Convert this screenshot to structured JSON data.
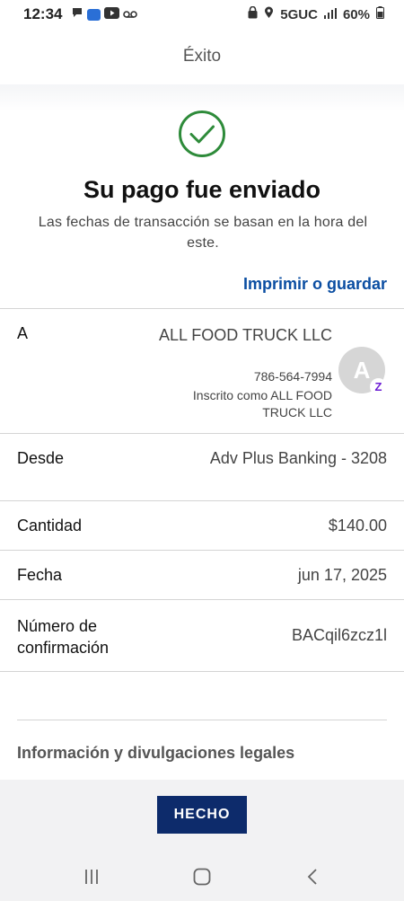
{
  "status_bar": {
    "time": "12:34",
    "network": "5GUC",
    "battery": "60%"
  },
  "header": {
    "title": "Éxito"
  },
  "confirmation": {
    "title": "Su pago fue enviado",
    "subtitle": "Las fechas de transacción se basan en la hora del este.",
    "print_link": "Imprimir o guardar"
  },
  "recipient": {
    "label": "A",
    "name": "ALL FOOD TRUCK LLC",
    "phone": "786-564-7994",
    "enrolled": "Inscrito como ALL FOOD TRUCK LLC",
    "avatar_letter": "A",
    "badge": "Z"
  },
  "details": {
    "from_label": "Desde",
    "from_value": "Adv Plus Banking - 3208",
    "amount_label": "Cantidad",
    "amount_value": "$140.00",
    "date_label": "Fecha",
    "date_value": "jun 17, 2025",
    "confirmation_label_line1": "Número de",
    "confirmation_label_line2": "confirmación",
    "confirmation_value": "BACqil6zcz1l"
  },
  "legal": {
    "title": "Información y divulgaciones legales"
  },
  "footer": {
    "done_label": "HECHO"
  },
  "colors": {
    "accent": "#0b4ea2",
    "brand_dark": "#0d2b6b",
    "success": "#2e8b3a",
    "zelle": "#6d1ed4"
  }
}
